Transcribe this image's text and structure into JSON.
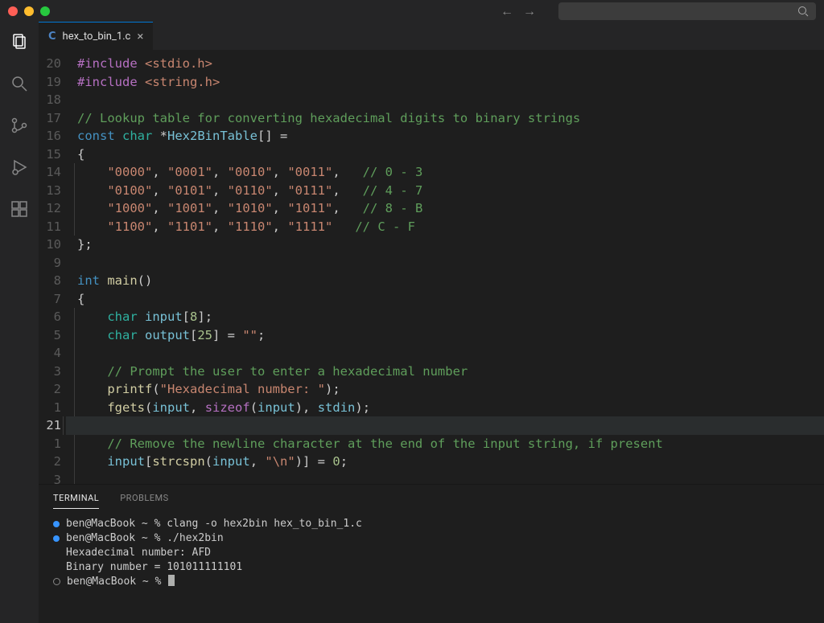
{
  "tab": {
    "lang_badge": "C",
    "filename": "hex_to_bin_1.c"
  },
  "activity_icons": [
    "explorer-icon",
    "search-icon",
    "scm-icon",
    "run-icon",
    "extensions-icon"
  ],
  "gutter": [
    {
      "n": "20"
    },
    {
      "n": "19"
    },
    {
      "n": "18"
    },
    {
      "n": "17"
    },
    {
      "n": "16"
    },
    {
      "n": "15"
    },
    {
      "n": "14"
    },
    {
      "n": "13"
    },
    {
      "n": "12"
    },
    {
      "n": "11"
    },
    {
      "n": "10"
    },
    {
      "n": "9"
    },
    {
      "n": "8"
    },
    {
      "n": "7"
    },
    {
      "n": "6"
    },
    {
      "n": "5"
    },
    {
      "n": "4"
    },
    {
      "n": "3"
    },
    {
      "n": "2"
    },
    {
      "n": "1"
    },
    {
      "n": "21",
      "cur": true
    },
    {
      "n": "1"
    },
    {
      "n": "2"
    },
    {
      "n": "3"
    }
  ],
  "code": {
    "l0": {
      "macro": "#include",
      "ang": " <stdio.h>"
    },
    "l1": {
      "macro": "#include",
      "ang": " <string.h>"
    },
    "l2": {
      "blank": true
    },
    "l3": {
      "com": "// Lookup table for converting hexadecimal digits to binary strings"
    },
    "l4": {
      "t": [
        [
          "kw",
          "const "
        ],
        [
          "typ2",
          "char "
        ],
        [
          "op",
          "*"
        ],
        [
          "id",
          "Hex2BinTable"
        ],
        [
          "punc",
          "[] ="
        ]
      ]
    },
    "l5": {
      "punc": "{"
    },
    "l6": {
      "quad": [
        "\"0000\"",
        "\"0001\"",
        "\"0010\"",
        "\"0011\""
      ],
      "com": "// 0 - 3",
      "trail": ","
    },
    "l7": {
      "quad": [
        "\"0100\"",
        "\"0101\"",
        "\"0110\"",
        "\"0111\""
      ],
      "com": "// 4 - 7",
      "trail": ","
    },
    "l8": {
      "quad": [
        "\"1000\"",
        "\"1001\"",
        "\"1010\"",
        "\"1011\""
      ],
      "com": "// 8 - B",
      "trail": ","
    },
    "l9": {
      "quad": [
        "\"1100\"",
        "\"1101\"",
        "\"1110\"",
        "\"1111\""
      ],
      "com": "// C - F",
      "trail": ""
    },
    "l10": {
      "punc": "};"
    },
    "l11": {
      "blank": true
    },
    "l12": {
      "t": [
        [
          "kw",
          "int "
        ],
        [
          "fn",
          "main"
        ],
        [
          "punc",
          "()"
        ]
      ]
    },
    "l13": {
      "punc": "{"
    },
    "l14": {
      "t": [
        [
          "typ2",
          "char "
        ],
        [
          "id",
          "input"
        ],
        [
          "punc",
          "["
        ],
        [
          "num",
          "8"
        ],
        [
          "punc",
          "];"
        ]
      ]
    },
    "l15": {
      "t": [
        [
          "typ2",
          "char "
        ],
        [
          "id",
          "output"
        ],
        [
          "punc",
          "["
        ],
        [
          "num",
          "25"
        ],
        [
          "punc",
          "] = "
        ],
        [
          "str",
          "\"\""
        ],
        [
          "punc",
          ";"
        ]
      ]
    },
    "l16": {
      "blank": true
    },
    "l17": {
      "com": "// Prompt the user to enter a hexadecimal number"
    },
    "l18": {
      "t": [
        [
          "fn",
          "printf"
        ],
        [
          "punc",
          "("
        ],
        [
          "str",
          "\"Hexadecimal number: \""
        ],
        [
          "punc",
          ");"
        ]
      ]
    },
    "l19": {
      "t": [
        [
          "fn",
          "fgets"
        ],
        [
          "punc",
          "("
        ],
        [
          "id",
          "input"
        ],
        [
          "punc",
          ", "
        ],
        [
          "kw2",
          "sizeof"
        ],
        [
          "punc",
          "("
        ],
        [
          "id",
          "input"
        ],
        [
          "punc",
          "), "
        ],
        [
          "id",
          "stdin"
        ],
        [
          "punc",
          ");"
        ]
      ]
    },
    "l20": {
      "blank": true,
      "current": true
    },
    "l21": {
      "com": "// Remove the newline character at the end of the input string, if present"
    },
    "l22": {
      "t": [
        [
          "id",
          "input"
        ],
        [
          "punc",
          "["
        ],
        [
          "fn",
          "strcspn"
        ],
        [
          "punc",
          "("
        ],
        [
          "id",
          "input"
        ],
        [
          "punc",
          ", "
        ],
        [
          "str",
          "\"\\n\""
        ],
        [
          "punc",
          ")] = "
        ],
        [
          "num",
          "0"
        ],
        [
          "punc",
          ";"
        ]
      ]
    },
    "l23": {
      "blank": true
    }
  },
  "panel": {
    "tabs": {
      "terminal": "TERMINAL",
      "problems": "PROBLEMS"
    },
    "term": {
      "t0": {
        "bullet": "blue",
        "prompt": "ben@MacBook ~ % ",
        "cmd": "clang -o hex2bin hex_to_bin_1.c"
      },
      "t1": {
        "bullet": "blue",
        "prompt": "ben@MacBook ~ % ",
        "cmd": "./hex2bin"
      },
      "t2": {
        "plain": "Hexadecimal number: AFD"
      },
      "t3": {
        "plain": "Binary number = 101011111101"
      },
      "t4": {
        "bullet": "hollow",
        "prompt": "ben@MacBook ~ % ",
        "cursor": true
      }
    }
  }
}
